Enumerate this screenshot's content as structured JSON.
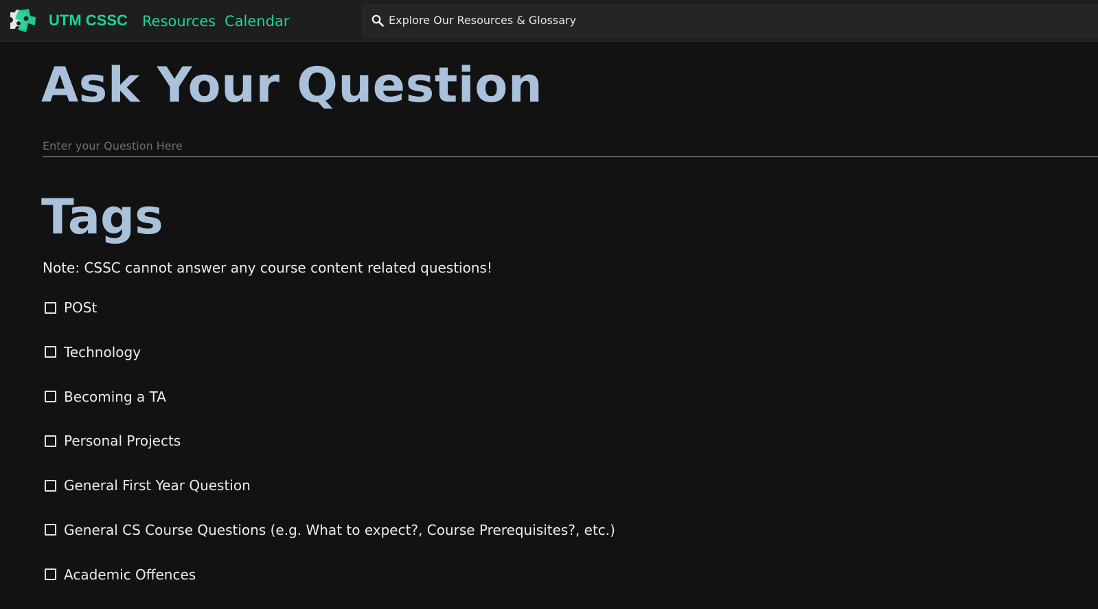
{
  "header": {
    "brand": "UTM CSSC",
    "nav": [
      {
        "label": "Resources"
      },
      {
        "label": "Calendar"
      }
    ],
    "search": {
      "placeholder": "Explore Our Resources & Glossary"
    }
  },
  "main": {
    "title": "Ask Your Question",
    "question_input": {
      "placeholder": "Enter your Question Here",
      "value": ""
    },
    "tags_heading": "Tags",
    "note": "Note: CSSC cannot answer any course content related questions!",
    "tags": [
      {
        "label": "POSt",
        "checked": false
      },
      {
        "label": "Technology",
        "checked": false
      },
      {
        "label": "Becoming a TA",
        "checked": false
      },
      {
        "label": "Personal Projects",
        "checked": false
      },
      {
        "label": "General First Year Question",
        "checked": false
      },
      {
        "label": "General CS Course Questions (e.g. What to expect?, Course Prerequisites?, etc.)",
        "checked": false
      },
      {
        "label": "Academic Offences",
        "checked": false
      }
    ]
  },
  "colors": {
    "accent": "#1fd39a",
    "heading": "#a9c1da",
    "background": "#121212",
    "topbar": "#1e1e1e"
  },
  "icons": {
    "logo": "puzzle-piece-logo",
    "search": "search-icon",
    "checkbox": "checkbox-unchecked-icon"
  }
}
